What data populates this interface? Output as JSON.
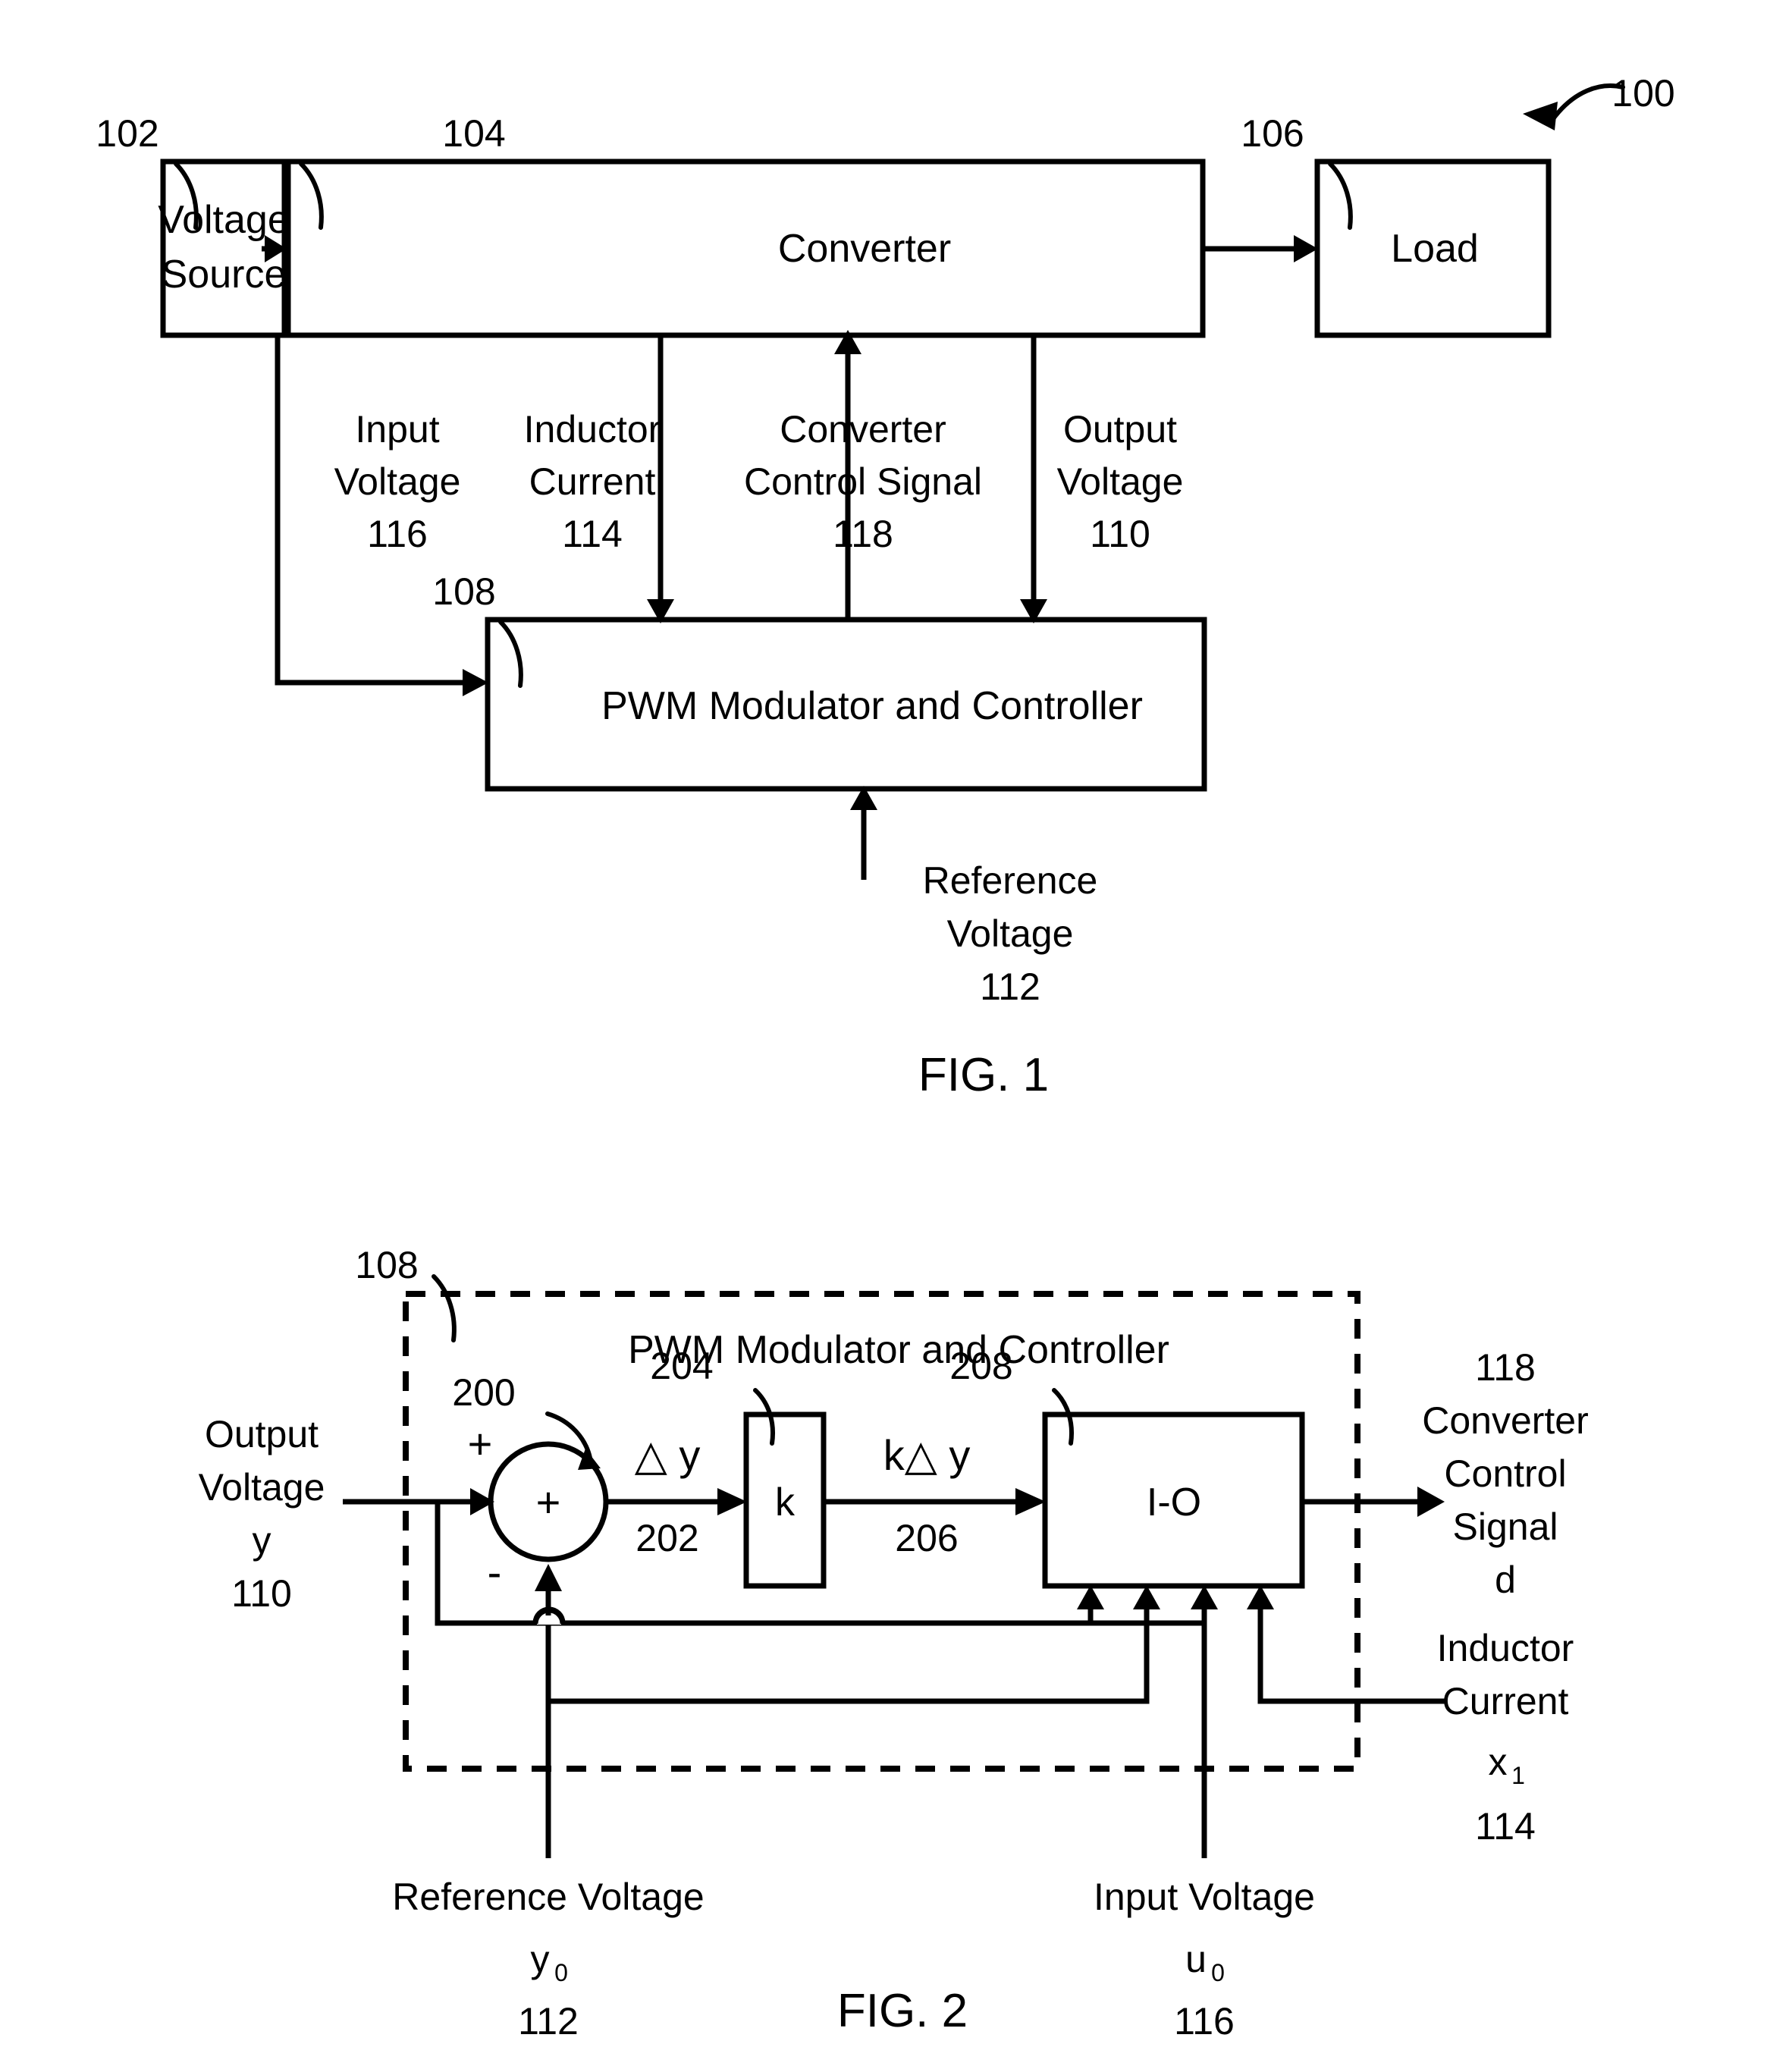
{
  "figure1": {
    "ref": "100",
    "blocks": [
      {
        "id": "voltage-source",
        "label_line1": "Voltage",
        "label_line2": "Source",
        "ref": "102"
      },
      {
        "id": "converter",
        "label": "Converter",
        "ref": "104"
      },
      {
        "id": "load",
        "label": "Load",
        "ref": "106"
      },
      {
        "id": "pwm-modulator-controller",
        "label": "PWM Modulator and Controller",
        "ref": "108"
      }
    ],
    "signals": [
      {
        "id": "input-voltage",
        "line1": "Input",
        "line2": "Voltage",
        "ref": "116"
      },
      {
        "id": "inductor-current",
        "line1": "Inductor",
        "line2": "Current",
        "ref": "114"
      },
      {
        "id": "converter-control-signal",
        "line1": "Converter",
        "line2": "Control Signal",
        "ref": "118"
      },
      {
        "id": "output-voltage",
        "line1": "Output",
        "line2": "Voltage",
        "ref": "110"
      },
      {
        "id": "reference-voltage",
        "line1": "Reference",
        "line2": "Voltage",
        "ref": "112"
      }
    ],
    "caption": "FIG. 1"
  },
  "figure2": {
    "enclosure": {
      "title": "PWM Modulator and Controller",
      "ref": "108"
    },
    "blocks": [
      {
        "id": "summer",
        "symbol": "+",
        "ref": "200",
        "plus_sign": "+",
        "minus_sign": "-"
      },
      {
        "id": "gain-k",
        "label": "k",
        "ref": "204"
      },
      {
        "id": "io-block",
        "label": "I-O",
        "ref": "208"
      }
    ],
    "signals": [
      {
        "id": "delta-y",
        "label": "△ y",
        "ref": "202"
      },
      {
        "id": "k-delta-y",
        "label": "k△ y",
        "ref": "206"
      }
    ],
    "ports": {
      "output_voltage": {
        "line1": "Output",
        "line2": "Voltage",
        "var": "y",
        "ref": "110"
      },
      "converter_control_signal": {
        "ref": "118",
        "line1": "Converter",
        "line2": "Control",
        "line3": "Signal",
        "var": "d"
      },
      "inductor_current": {
        "line1": "Inductor",
        "line2": "Current",
        "var": "x",
        "var_sub": "1",
        "ref": "114"
      },
      "reference_voltage": {
        "label": "Reference Voltage",
        "var": "y",
        "var_sub": "0",
        "ref": "112"
      },
      "input_voltage": {
        "label": "Input Voltage",
        "var": "u",
        "var_sub": "0",
        "ref": "116"
      }
    },
    "caption": "FIG. 2"
  },
  "colors": {
    "ink": "#000000",
    "paper": "#ffffff"
  }
}
